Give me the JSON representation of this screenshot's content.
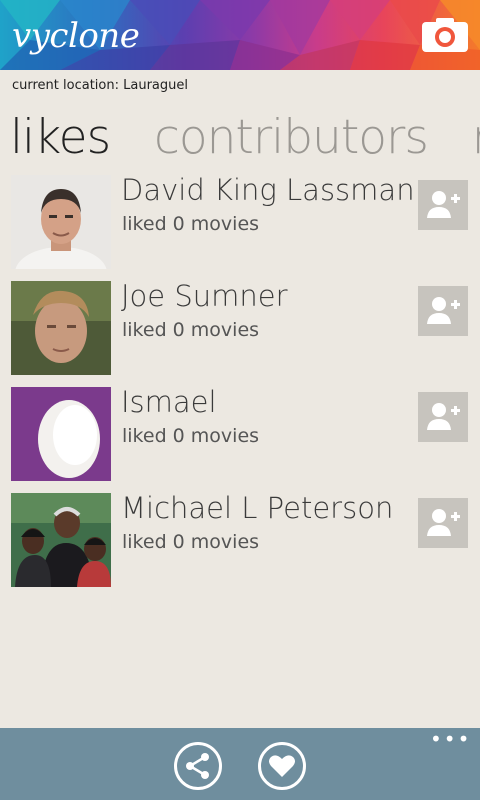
{
  "header": {
    "logo_text": "vyclone",
    "camera_icon": "camera-icon"
  },
  "location_text": "current location: Lauraguel",
  "tabs": [
    {
      "label": "likes"
    },
    {
      "label": "contributors"
    },
    {
      "label": "r"
    }
  ],
  "users": [
    {
      "name": "David King Lassman",
      "subtitle": "liked 0 movies",
      "avatar": "portrait-photo"
    },
    {
      "name": "Joe Sumner",
      "subtitle": "liked 0 movies",
      "avatar": "portrait-photo"
    },
    {
      "name": "Ismael",
      "subtitle": "liked 0 movies",
      "avatar": "default-egg-avatar"
    },
    {
      "name": "Michael L Peterson",
      "subtitle": "liked 0 movies",
      "avatar": "group-photo"
    }
  ],
  "appbar": {
    "buttons": [
      {
        "icon": "share-icon"
      },
      {
        "icon": "heart-icon"
      }
    ],
    "more_label": "•••"
  },
  "colors": {
    "background": "#ece8e1",
    "appbar": "#6f8e9e",
    "egg_bg": "#7b3a8c",
    "add_button": "#c7c4be"
  }
}
